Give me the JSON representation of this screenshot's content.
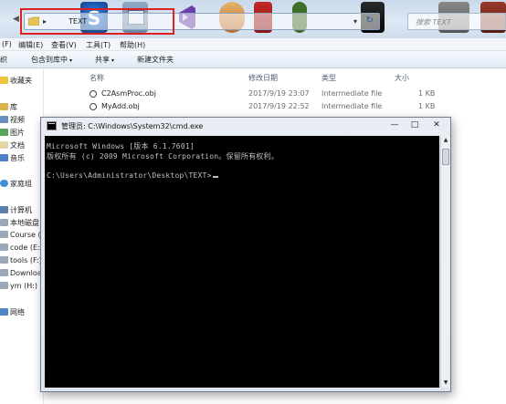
{
  "explorer": {
    "address": {
      "crumb": "TEXT",
      "sep": "▸"
    },
    "search": {
      "placeholder": "搜索 TEXT"
    },
    "menu": [
      {
        "label": "(F)"
      },
      {
        "label": "编辑(E)"
      },
      {
        "label": "查看(V)"
      },
      {
        "label": "工具(T)"
      },
      {
        "label": "帮助(H)"
      }
    ],
    "toolbar": [
      {
        "label": "织"
      },
      {
        "label": "包含到库中"
      },
      {
        "label": "共享"
      },
      {
        "label": "新建文件夹"
      }
    ],
    "nav": [
      {
        "label": "收藏夹",
        "icon": "star-icon"
      },
      {
        "label": "库",
        "icon": "library-icon"
      },
      {
        "label": "视频",
        "icon": "video-icon"
      },
      {
        "label": "图片",
        "icon": "picture-icon"
      },
      {
        "label": "文档",
        "icon": "document-icon"
      },
      {
        "label": "音乐",
        "icon": "music-icon"
      },
      {
        "label": "家庭组",
        "icon": "homegroup-icon"
      },
      {
        "label": "计算机",
        "icon": "computer-icon"
      },
      {
        "label": "本地磁盘",
        "icon": "drive-icon"
      },
      {
        "label": "Course (I",
        "icon": "drive-icon"
      },
      {
        "label": "code (E:)",
        "icon": "drive-icon"
      },
      {
        "label": "tools (F:)",
        "icon": "drive-icon"
      },
      {
        "label": "Downloa",
        "icon": "drive-icon"
      },
      {
        "label": "ym (H:)",
        "icon": "drive-icon"
      },
      {
        "label": "网络",
        "icon": "network-icon"
      }
    ],
    "columns": {
      "name": "名称",
      "modified": "修改日期",
      "type": "类型",
      "size": "大小"
    },
    "files": [
      {
        "name": "C2AsmProc.obj",
        "modified": "2017/9/19 23:07",
        "type": "Intermediate file",
        "size": "1 KB"
      },
      {
        "name": "MyAdd.obj",
        "modified": "2017/9/19 22:52",
        "type": "Intermediate file",
        "size": "1 KB"
      }
    ]
  },
  "cmd": {
    "title": "管理员: C:\\Windows\\System32\\cmd.exe",
    "buttons": {
      "minimize": "—",
      "maximize": "□",
      "close": "✕"
    },
    "lines": [
      "Microsoft Windows [版本 6.1.7601]",
      "版权所有 (c) 2009 Microsoft Corporation。保留所有权利。",
      "",
      "C:\\Users\\Administrator\\Desktop\\TEXT>"
    ]
  },
  "colors": {
    "highlight": "#e02020",
    "console_bg": "#000000",
    "console_fg": "#c0c0c0"
  }
}
